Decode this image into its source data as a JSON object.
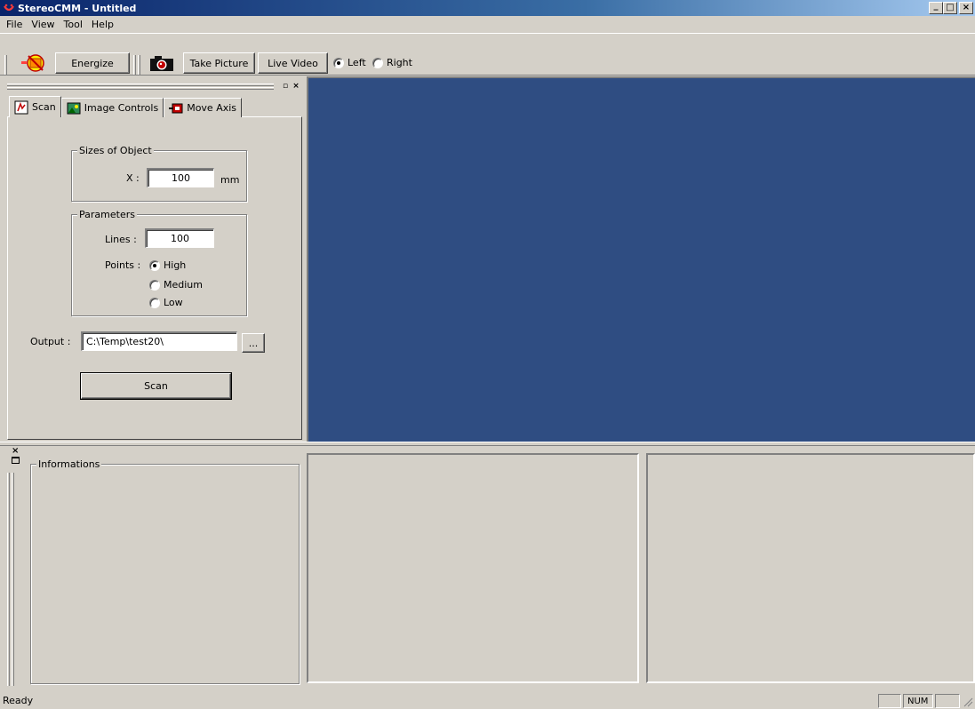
{
  "window": {
    "title": "StereoCMM - Untitled",
    "controls": {
      "minimize": "_",
      "maximize": "□",
      "close": "×"
    }
  },
  "menu": {
    "items": [
      {
        "label": "File",
        "mnemonic": "F"
      },
      {
        "label": "View",
        "mnemonic": "V"
      },
      {
        "label": "Tool",
        "mnemonic": "T"
      },
      {
        "label": "Help",
        "mnemonic": "H"
      }
    ]
  },
  "toolbar": {
    "energize_label": "Energize",
    "take_picture_label": "Take Picture",
    "live_video_label": "Live Video",
    "camera_options": [
      {
        "label": "Left",
        "selected": true
      },
      {
        "label": "Right",
        "selected": false
      }
    ],
    "icons": {
      "energize": "energize-icon",
      "camera": "camera-icon"
    }
  },
  "left_panel": {
    "tabs": [
      {
        "label": "Scan",
        "icon": "scan-icon",
        "active": true
      },
      {
        "label": "Image Controls",
        "icon": "image-controls-icon",
        "active": false
      },
      {
        "label": "Move Axis",
        "icon": "move-axis-icon",
        "active": false
      }
    ],
    "sizes_group": {
      "title": "Sizes of Object",
      "x_label": "X :",
      "x_value": "100",
      "x_unit": "mm"
    },
    "parameters_group": {
      "title": "Parameters",
      "lines_label": "Lines :",
      "lines_value": "100",
      "points_label": "Points :",
      "points_options": [
        {
          "label": "High",
          "selected": true
        },
        {
          "label": "Medium",
          "selected": false
        },
        {
          "label": "Low",
          "selected": false
        }
      ]
    },
    "output": {
      "label": "Output :",
      "value": "C:\\Temp\\test20\\",
      "browse_label": "..."
    },
    "scan_button": "Scan"
  },
  "bottom": {
    "informations_title": "Informations"
  },
  "status": {
    "text": "Ready",
    "indicators": [
      "",
      "NUM",
      ""
    ]
  },
  "colors": {
    "titlebar_start": "#0a246a",
    "titlebar_end": "#a6caf0",
    "face": "#d4d0c8",
    "main_view": "#2f4d82"
  }
}
